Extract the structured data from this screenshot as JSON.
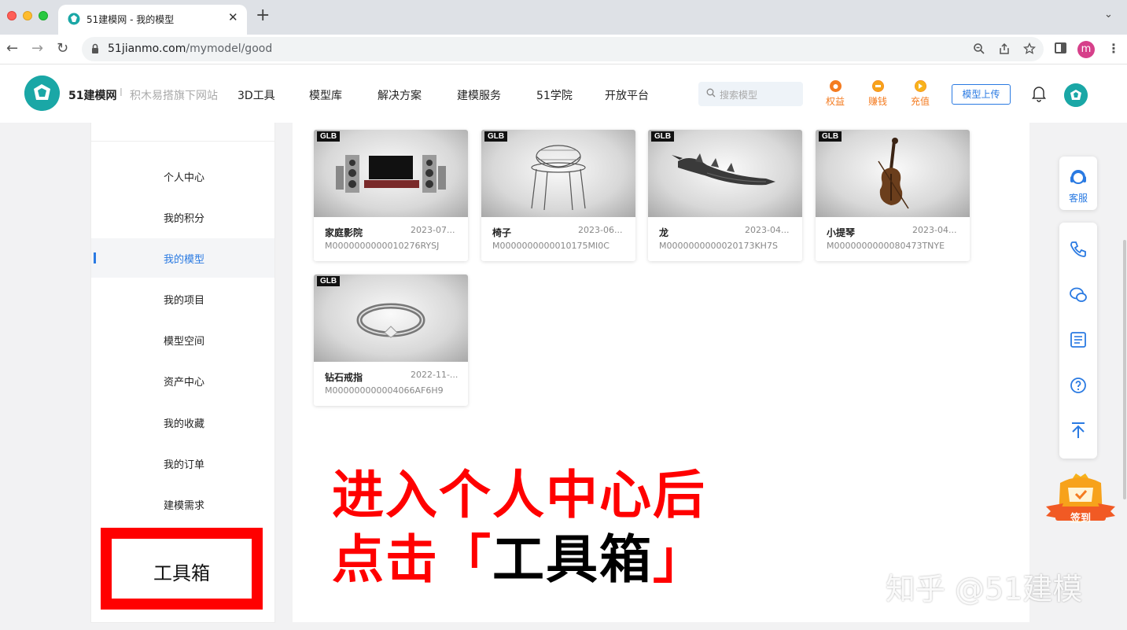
{
  "browser": {
    "tab_title": "51建模网 - 我的模型",
    "tab_close": "✕",
    "new_tab": "+",
    "tab_menu": "⌄",
    "url_host": "51jianmo.com",
    "url_path": "/mymodel/good",
    "profile_initial": "m",
    "nav_back": "←",
    "nav_forward": "→",
    "nav_reload": "↻"
  },
  "header": {
    "logo_name": "51建模网",
    "logo_sep": "I",
    "slogan": "积木易搭旗下网站",
    "nav": [
      "3D工具",
      "模型库",
      "解决方案",
      "建模服务",
      "51学院",
      "开放平台"
    ],
    "search_placeholder": "搜索模型",
    "quick_links": [
      {
        "label": "权益",
        "icon": "medal-icon"
      },
      {
        "label": "赚钱",
        "icon": "coin-icon"
      },
      {
        "label": "充值",
        "icon": "recharge-icon"
      }
    ],
    "upload_label": "模型上传",
    "accent_color": "#2a7ae2",
    "orange_color": "#f47b20"
  },
  "sidebar": {
    "items": [
      "个人中心",
      "我的积分",
      "我的模型",
      "我的项目",
      "模型空间",
      "资产中心",
      "我的收藏",
      "我的订单",
      "建模需求"
    ],
    "active_index": 2,
    "toolbox_label": "工具箱"
  },
  "models": [
    {
      "badge": "GLB",
      "name": "家庭影院",
      "date": "2023-07...",
      "code": "M0000000000010276RYSJ",
      "thumb": "home-theater"
    },
    {
      "badge": "GLB",
      "name": "椅子",
      "date": "2023-06...",
      "code": "M0000000000010175MI0C",
      "thumb": "chair"
    },
    {
      "badge": "GLB",
      "name": "龙",
      "date": "2023-04...",
      "code": "M0000000000020173KH7S",
      "thumb": "dragon"
    },
    {
      "badge": "GLB",
      "name": "小提琴",
      "date": "2023-04...",
      "code": "M0000000000080473TNYE",
      "thumb": "violin"
    },
    {
      "badge": "GLB",
      "name": "钻石戒指",
      "date": "2022-11-...",
      "code": "M000000000004066AF6H9",
      "thumb": "ring"
    }
  ],
  "overlay": {
    "line1": "进入个人中心后",
    "line2_prefix": "点击「",
    "line2_highlight": "工具箱",
    "line2_suffix": "」"
  },
  "watermark": "知乎 @51建模",
  "float": {
    "service_label": "客服",
    "sign_label": "签到",
    "icons": [
      "phone-icon",
      "wechat-icon",
      "news-icon",
      "help-icon",
      "back-to-top-icon"
    ]
  }
}
